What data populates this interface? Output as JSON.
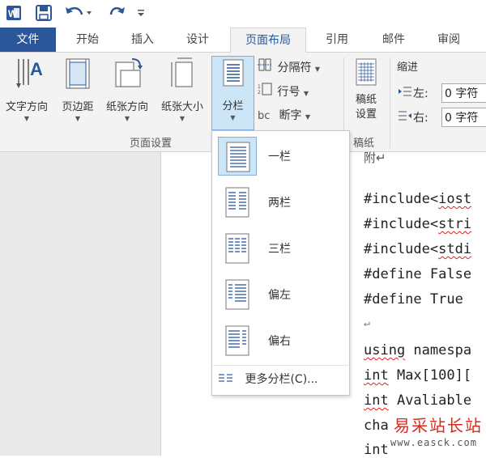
{
  "quick_access": {
    "word_logo": "W",
    "icons": [
      "word-logo-icon",
      "save-icon",
      "undo-icon",
      "redo-icon",
      "customize-qat-icon"
    ]
  },
  "tabs": [
    {
      "label": "文件"
    },
    {
      "label": "开始"
    },
    {
      "label": "插入"
    },
    {
      "label": "设计"
    },
    {
      "label": "页面布局"
    },
    {
      "label": "引用"
    },
    {
      "label": "邮件"
    },
    {
      "label": "审阅"
    }
  ],
  "ribbon": {
    "page_setup": {
      "text_direction": "文字方向",
      "margins": "页边距",
      "orientation": "纸张方向",
      "size": "纸张大小",
      "columns": "分栏",
      "breaks": "分隔符",
      "line_numbers": "行号",
      "hyphenation": "断字",
      "hyphenation_prefix": "bc",
      "group_label": "页面设置"
    },
    "manuscript": {
      "label_line1": "稿纸",
      "label_line2": "设置",
      "group_label": "稿纸"
    },
    "indent": {
      "title": "缩进",
      "left_label": "左:",
      "left_value": "0 字符",
      "right_label": "右:",
      "right_value": "0 字符"
    }
  },
  "columns_menu": {
    "items": [
      {
        "label": "一栏",
        "selected": true
      },
      {
        "label": "两栏"
      },
      {
        "label": "三栏"
      },
      {
        "label": "偏左"
      },
      {
        "label": "偏右"
      }
    ],
    "more": "更多分栏(C)..."
  },
  "document": {
    "lines": [
      "附↵",
      "",
      "#include<iost",
      "#include<stri",
      "#include<stdi",
      "#define False",
      "#define True ",
      "↵",
      "using namespa",
      "int Max[100][",
      "int Avaliable",
      "cha",
      "int"
    ]
  },
  "watermark": {
    "title": "易采站长站",
    "url": "www.easck.com"
  },
  "colors": {
    "accent": "#2b579a",
    "ribbon_bg": "#f3f3f3",
    "selected_fill": "#cde6f7",
    "selected_border": "#84acdd",
    "watermark_red": "#d9281c"
  }
}
